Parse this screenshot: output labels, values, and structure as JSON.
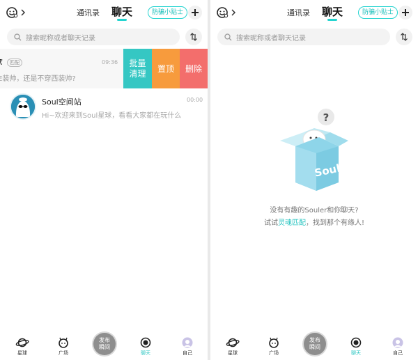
{
  "header": {
    "tab_contacts": "通讯录",
    "tab_chat": "聊天",
    "anti_scam": "防骗小贴士"
  },
  "search": {
    "placeholder": "搜索昵称或者聊天记录"
  },
  "left": {
    "swiped_row": {
      "name_fragment": "₹",
      "badge": "匹配",
      "message": "E装帅，还是不穿西装帅?",
      "time": "09:36"
    },
    "swipe_actions": {
      "clear": "批量清理",
      "pin": "置顶",
      "delete": "删除"
    },
    "soul_row": {
      "name": "Soul空间站",
      "message": "Hi~欢迎来到Soul星球，看看大家都在玩什么",
      "time": "00:00"
    }
  },
  "right": {
    "empty_line1": "没有有趣的Souler和你聊天?",
    "empty_pre": "试试",
    "empty_link": "灵魂匹配",
    "empty_post": "，找到那个有缘人!",
    "box_label": "Soul",
    "question": "?"
  },
  "nav": {
    "stars": "星球",
    "square": "广场",
    "publish": "发布瞬间",
    "chat": "聊天",
    "me": "自己"
  },
  "colors": {
    "accent": "#25d4d0",
    "clear": "#35c7c3",
    "pin": "#f79b3d",
    "delete": "#f36e6c"
  }
}
